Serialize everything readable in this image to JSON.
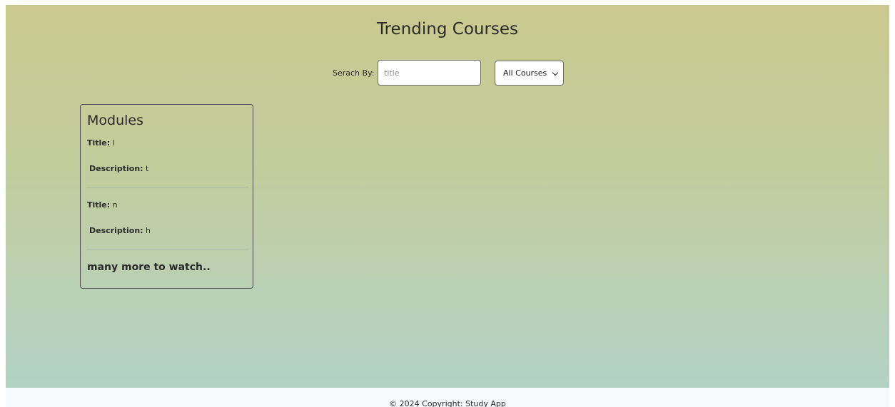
{
  "page": {
    "title": "Trending Courses"
  },
  "search": {
    "label": "Serach By:",
    "placeholder": "title",
    "value": "",
    "filter_selected": "All Courses",
    "filter_options": [
      "All Courses"
    ]
  },
  "card": {
    "heading": "Modules",
    "title_label": "Title:",
    "description_label": "Description:",
    "modules": [
      {
        "title": "l",
        "description": "t"
      },
      {
        "title": "n",
        "description": "h"
      }
    ],
    "more_text": "many more to watch.."
  },
  "footer": {
    "copyright": "© 2024 Copyright: Study App"
  },
  "colors": {
    "gradient_top": "#cbc98f",
    "gradient_bottom": "#b3d2c6",
    "footer_bg": "#f8f9fa",
    "card_border": "#4e4e4e"
  },
  "icons": {
    "select_arrow": "chevron-down-icon"
  }
}
